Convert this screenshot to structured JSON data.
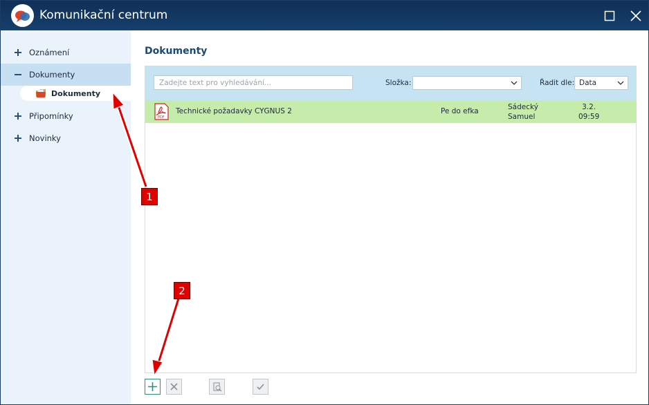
{
  "window": {
    "title": "Komunikační centrum",
    "accent_color": "#15406d",
    "maximize_icon": "maximize-icon",
    "close_icon": "close-icon"
  },
  "sidebar": {
    "items": [
      {
        "label": "Oznámení",
        "sign": "+",
        "expanded": false
      },
      {
        "label": "Dokumenty",
        "sign": "−",
        "expanded": true,
        "children": [
          {
            "label": "Dokumenty",
            "icon": "folder-icon",
            "selected": true
          }
        ]
      },
      {
        "label": "Připomínky",
        "sign": "+",
        "expanded": false
      },
      {
        "label": "Novinky",
        "sign": "+",
        "expanded": false
      }
    ]
  },
  "main": {
    "title": "Dokumenty",
    "search": {
      "placeholder": "Zadejte text pro vyhledávání..."
    },
    "folder_filter": {
      "label": "Složka:",
      "value": ""
    },
    "sort": {
      "label": "Řadit dle:",
      "value": "Data"
    },
    "documents": [
      {
        "icon": "pdf-icon",
        "icon_text": "PDF",
        "name": "Technické požadavky CYGNUS 2",
        "folder": "Pe do efka",
        "author_line1": "Sádecký",
        "author_line2": "Samuel",
        "date_line1": "3.2.",
        "date_line2": "09:59",
        "row_color": "#c6ecac"
      }
    ]
  },
  "toolbar": {
    "buttons": [
      {
        "name": "add",
        "icon": "plus-icon",
        "enabled": true
      },
      {
        "name": "delete",
        "icon": "x-icon",
        "enabled": false
      },
      {
        "name": "preview",
        "icon": "search-document-icon",
        "enabled": false
      },
      {
        "name": "confirm",
        "icon": "check-icon",
        "enabled": false
      }
    ]
  },
  "annotations": {
    "marker_1": "1",
    "marker_2": "2",
    "color": "#e00000"
  }
}
